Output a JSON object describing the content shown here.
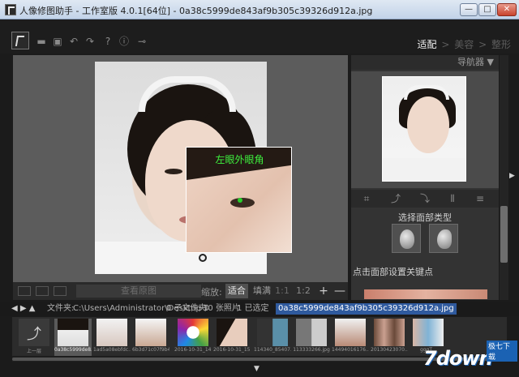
{
  "window": {
    "title": "人像修图助手 - 工作室版 4.0.1[64位] - 0a38c5999de843af9b305c39326d912a.jpg",
    "minimize_glyph": "—",
    "maximize_glyph": "□",
    "close_glyph": "✕"
  },
  "toolbar": {
    "icons": [
      "logo",
      "open-folder",
      "save",
      "undo",
      "redo",
      "help",
      "info",
      "plugin"
    ],
    "glyphs": {
      "open": "▬",
      "save": "▣",
      "undo": "↶",
      "redo": "↷",
      "help": "?",
      "info": "ⓘ",
      "plugin": "⊸"
    },
    "modes": [
      {
        "label": "适配",
        "active": true
      },
      {
        "label": "美容",
        "active": false
      },
      {
        "label": "整形",
        "active": false
      }
    ],
    "mode_sep": ">"
  },
  "canvas": {
    "loupe_label": "左眼外眼角",
    "view_original": "查看原图",
    "zoom_label": "缩放:",
    "zoom_fit": "适合",
    "zoom_fill": "填满",
    "zoom_11": "1:1",
    "zoom_12": "1:2 ▾",
    "zoom_in": "+",
    "zoom_out": "—"
  },
  "right_panel": {
    "navigator_label": "导航器 ▼",
    "face_type_label": "选择面部类型",
    "set_keypoint_label": "点击面部设置关键点",
    "tool_glyphs": [
      "⌗",
      "⤴",
      "⤵",
      "⫴",
      "≡"
    ]
  },
  "file_browser": {
    "nav": "◀ ▶ ▲",
    "folder_label": "文件夹:",
    "path": "C:\\Users\\Administrator\\Desktop ⇕",
    "subfolders": "0 子文件夹",
    "photos": "10 张照片",
    "selected": "1 已选定",
    "current_file": "0a38c5999de843af9b305c39326d912a.jpg",
    "items": [
      {
        "caption": "上一层"
      },
      {
        "caption": "0a38c5999de8..."
      },
      {
        "caption": "1ad5a08ebfdc..."
      },
      {
        "caption": "6b3d71c07f9b4..."
      },
      {
        "caption": "2016-10-31_14..."
      },
      {
        "caption": "2016-10-31_15..."
      },
      {
        "caption": "114340_85407..."
      },
      {
        "caption": "113333266.jpg"
      },
      {
        "caption": "14494016176..."
      },
      {
        "caption": "20130423070..."
      },
      {
        "caption": "ggqT..."
      }
    ]
  },
  "watermark": {
    "text": "7down",
    "badge": "极七下载"
  },
  "colors": {
    "accent_green": "#3ef23e",
    "selection_blue": "#2f5a9e",
    "background": "#1b1b1b"
  }
}
